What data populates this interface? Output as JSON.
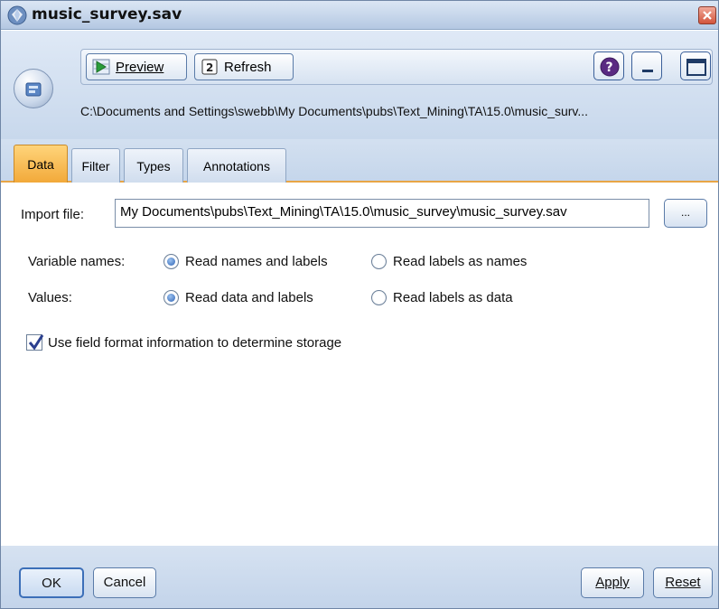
{
  "window": {
    "title": "music_survey.sav"
  },
  "toolbar": {
    "preview_label": "Preview",
    "refresh_label": "Refresh",
    "path": "C:\\Documents and Settings\\swebb\\My Documents\\pubs\\Text_Mining\\TA\\15.0\\music_surv..."
  },
  "tabs": [
    {
      "label": "Data",
      "active": true
    },
    {
      "label": "Filter",
      "active": false
    },
    {
      "label": "Types",
      "active": false
    },
    {
      "label": "Annotations",
      "active": false
    }
  ],
  "form": {
    "import_file_label": "Import file:",
    "import_file_value": "My Documents\\pubs\\Text_Mining\\TA\\15.0\\music_survey\\music_survey.sav",
    "browse_label": "...",
    "variable_names_label": "Variable names:",
    "variable_names_options": [
      {
        "label": "Read names and labels",
        "selected": true
      },
      {
        "label": "Read labels as names",
        "selected": false
      }
    ],
    "values_label": "Values:",
    "values_options": [
      {
        "label": "Read data and labels",
        "selected": true
      },
      {
        "label": "Read labels as data",
        "selected": false
      }
    ],
    "use_field_format_label": "Use field format information to determine storage",
    "use_field_format_checked": true
  },
  "footer": {
    "ok_label": "OK",
    "cancel_label": "Cancel",
    "apply_label": "Apply",
    "reset_label": "Reset"
  },
  "colors": {
    "active_tab": "#f2a93a",
    "chrome": "#c8d8ec",
    "close_button": "#d2543b"
  }
}
